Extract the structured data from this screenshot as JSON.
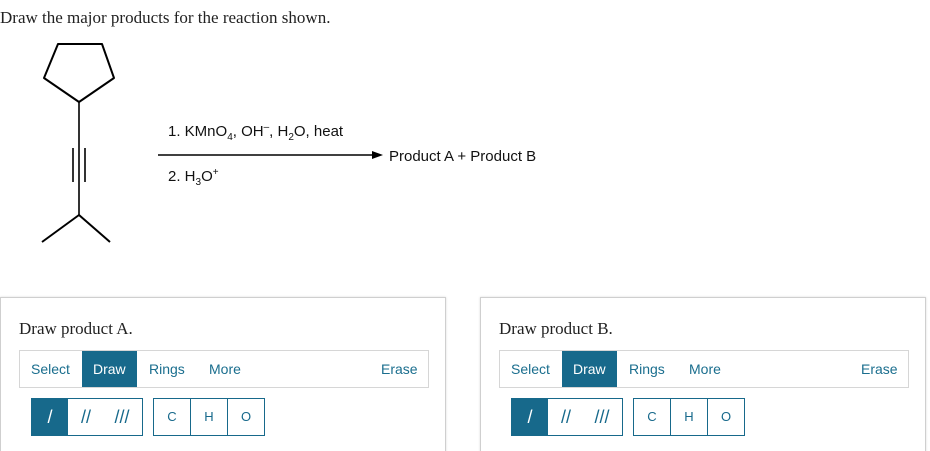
{
  "question": "Draw the major products for the reaction shown.",
  "reaction": {
    "step1_prefix": "1. KMnO",
    "step1_sub4": "4",
    "step1_mid": ", OH",
    "step1_minus": "–",
    "step1_h": ", H",
    "step1_sub2": "2",
    "step1_end": "O, heat",
    "step2_prefix": "2. H",
    "step2_sub3": "3",
    "step2_o": "O",
    "step2_plus": "+",
    "product": "Product A + Product B"
  },
  "panels": [
    {
      "title": "Draw product A.",
      "tools": {
        "select": "Select",
        "draw": "Draw",
        "rings": "Rings",
        "more": "More",
        "erase": "Erase"
      },
      "bonds": {
        "single": "/",
        "double": "//",
        "triple": "///"
      },
      "atoms": [
        "C",
        "H",
        "O"
      ],
      "active_tool": "Draw",
      "active_bond": "single"
    },
    {
      "title": "Draw product B.",
      "tools": {
        "select": "Select",
        "draw": "Draw",
        "rings": "Rings",
        "more": "More",
        "erase": "Erase"
      },
      "bonds": {
        "single": "/",
        "double": "//",
        "triple": "///"
      },
      "atoms": [
        "C",
        "H",
        "O"
      ],
      "active_tool": "Draw",
      "active_bond": "single"
    }
  ],
  "colors": {
    "accent": "#17698b",
    "text": "#222222",
    "border": "#cfcfcf"
  }
}
